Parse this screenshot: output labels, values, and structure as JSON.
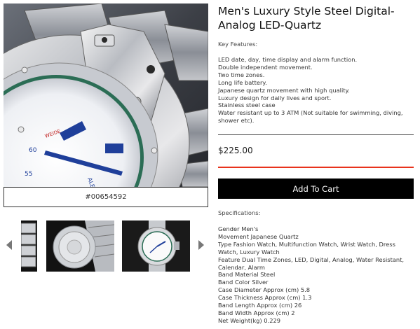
{
  "product": {
    "title": "Men's Luxury Style Steel Digital-Analog LED-Quartz",
    "sku": "#00654592",
    "price": "$225.00",
    "add_to_cart_label": "Add To Cart",
    "key_features_label": "Key Features:",
    "key_features": [
      "LED date, day, time display and alarm function.",
      "Double independent movement.",
      "Two time zones.",
      "Long life battery.",
      "Japanese quartz movement with high quality.",
      "Luxury design for daily lives and sport.",
      "Stainless steel case",
      "Water resistant up to 3 ATM (Not suitable for swimming, diving, shower etc)."
    ],
    "specifications_label": "Specifications:",
    "specifications": [
      "Gender Men's",
      "Movement Japanese Quartz",
      "Type Fashion Watch, Multifunction Watch, Wrist Watch, Dress Watch, Luxury Watch",
      "Feature Dual Time Zones, LED, Digital, Analog, Water Resistant, Calendar, Alarm",
      "Band Material Steel",
      "Band Color Silver",
      "Case Diameter Approx (cm) 5.8",
      "Case Thickness Approx (cm) 1.3",
      "Band Length Approx (cm) 26",
      "Band Width Approx (cm) 2",
      "Net Weight(kg) 0.229"
    ]
  },
  "gallery": {
    "main_image_icon": "watch-closeup-image",
    "thumbnail_icons": [
      "watch-band-thumbnail",
      "watch-caseback-thumbnail",
      "watch-front-thumbnail"
    ],
    "prev_icon": "chevron-left-icon",
    "next_icon": "chevron-right-icon"
  },
  "colors": {
    "accent_rule": "#e8331c",
    "button_bg": "#000000",
    "watch_dial_blue": "#1f3f9a"
  }
}
